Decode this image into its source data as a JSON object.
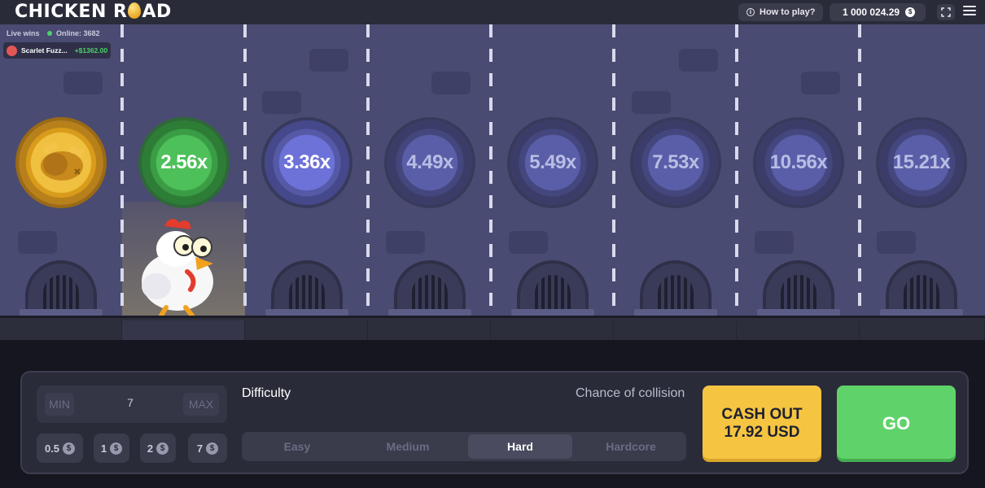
{
  "header": {
    "logo_text_1": "CHICKEN R",
    "logo_text_2": "AD",
    "how_to_play": "How to play?",
    "balance": "1 000 024.29",
    "currency_symbol": "$"
  },
  "live": {
    "label": "Live wins",
    "online": "Online: 3682",
    "wins": [
      {
        "name": "Scarlet Fuzz...",
        "amount": "+$1362.00"
      }
    ]
  },
  "lanes": {
    "multipliers": [
      "2.56x",
      "3.36x",
      "4.49x",
      "5.49x",
      "7.53x",
      "10.56x",
      "15.21x"
    ],
    "passed_count": 1,
    "current_index": 1
  },
  "controls": {
    "min": "MIN",
    "max": "MAX",
    "bet": "7",
    "chips": [
      "0.5",
      "1",
      "2",
      "7"
    ],
    "chip_symbol": "$",
    "difficulty_label": "Difficulty",
    "collision_label": "Chance of collision",
    "difficulties": [
      "Easy",
      "Medium",
      "Hard",
      "Hardcore"
    ],
    "selected_difficulty": "Hard",
    "cashout_line1": "CASH OUT",
    "cashout_line2": "17.92 USD",
    "go": "GO"
  },
  "colors": {
    "cashout": "#f5c542",
    "go": "#5fd36a",
    "win_amount": "#4ed06a",
    "active_coin": "#4ec05a"
  }
}
